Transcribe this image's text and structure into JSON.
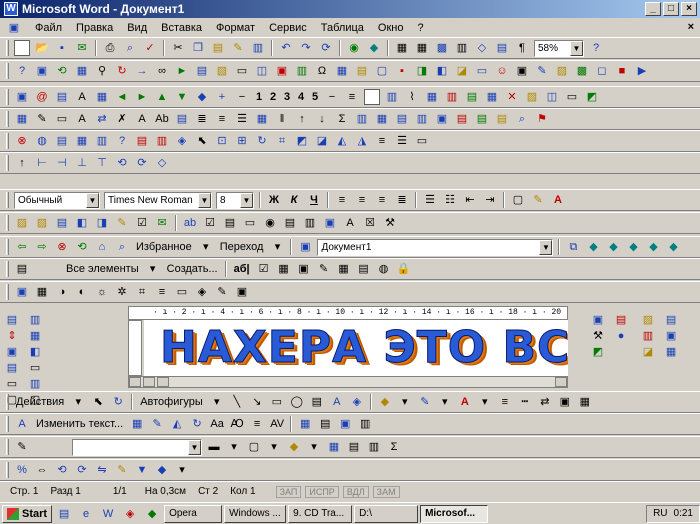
{
  "window": {
    "title": "Microsoft Word - Документ1",
    "min": "_",
    "max": "□",
    "close": "×"
  },
  "menu": {
    "items": [
      "Файл",
      "Правка",
      "Вид",
      "Вставка",
      "Формат",
      "Сервис",
      "Таблица",
      "Окно",
      "?"
    ],
    "close_doc": "×"
  },
  "toolbar_std": {
    "zoom": "58%"
  },
  "toolbar_format": {
    "style": "Обычный",
    "font": "Times New Roman",
    "size": "8",
    "bold": "Ж",
    "italic": "К",
    "underline": "Ч"
  },
  "toolbar_numbers": [
    "1",
    "2",
    "3",
    "4",
    "5"
  ],
  "toolbar_web": {
    "favorites": "Избранное",
    "go": "Переход",
    "address": "Документ1"
  },
  "toolbar_autotext": {
    "all_items": "Все элементы",
    "create": "Создать...",
    "abl": "аб|"
  },
  "ruler": {
    "text": "· ı · 2 · ı · 4 · ı · 6 · ı · 8 · ı · 10 · ı · 12 · ı · 14 · ı · 16 · ı · 18 · ı · 20 ·"
  },
  "document": {
    "wordart": "НАХЕРА ЭТО ВСЕ ?"
  },
  "toolbar_draw": {
    "actions": "Действия",
    "autoshapes": "Автофигуры"
  },
  "toolbar_edit": {
    "change_text": "Изменить текст..."
  },
  "status": {
    "page": "Стр. 1",
    "section": "Разд 1",
    "pages": "1/1",
    "at": "На 0,3см",
    "line": "Ст 2",
    "col": "Кол 1",
    "rec": "ЗАП",
    "trk": "ИСПР",
    "ext": "ВДЛ",
    "ovr": "ЗАМ"
  },
  "taskbar": {
    "start": "Start",
    "tasks": [
      "Opera",
      "Windows ...",
      "9. CD Tra...",
      "D:\\",
      "Microsof..."
    ],
    "lang": "RU",
    "time": "0:21"
  }
}
